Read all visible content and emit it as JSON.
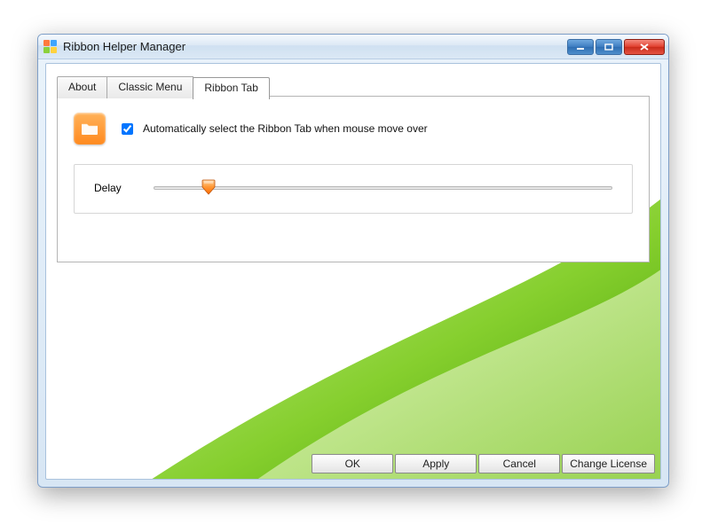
{
  "window": {
    "title": "Ribbon Helper Manager"
  },
  "tabs": [
    {
      "label": "About",
      "active": false
    },
    {
      "label": "Classic Menu",
      "active": false
    },
    {
      "label": "Ribbon Tab",
      "active": true
    }
  ],
  "ribbonTab": {
    "autoSelectLabel": "Automatically select the Ribbon Tab when mouse move over",
    "autoSelectChecked": true,
    "delayLabel": "Delay",
    "delayPercent": 12
  },
  "buttons": {
    "ok": "OK",
    "apply": "Apply",
    "cancel": "Cancel",
    "changeLicense": "Change License"
  },
  "colors": {
    "accentGreen": "#5fb400",
    "orange": "#ff8a1f"
  }
}
